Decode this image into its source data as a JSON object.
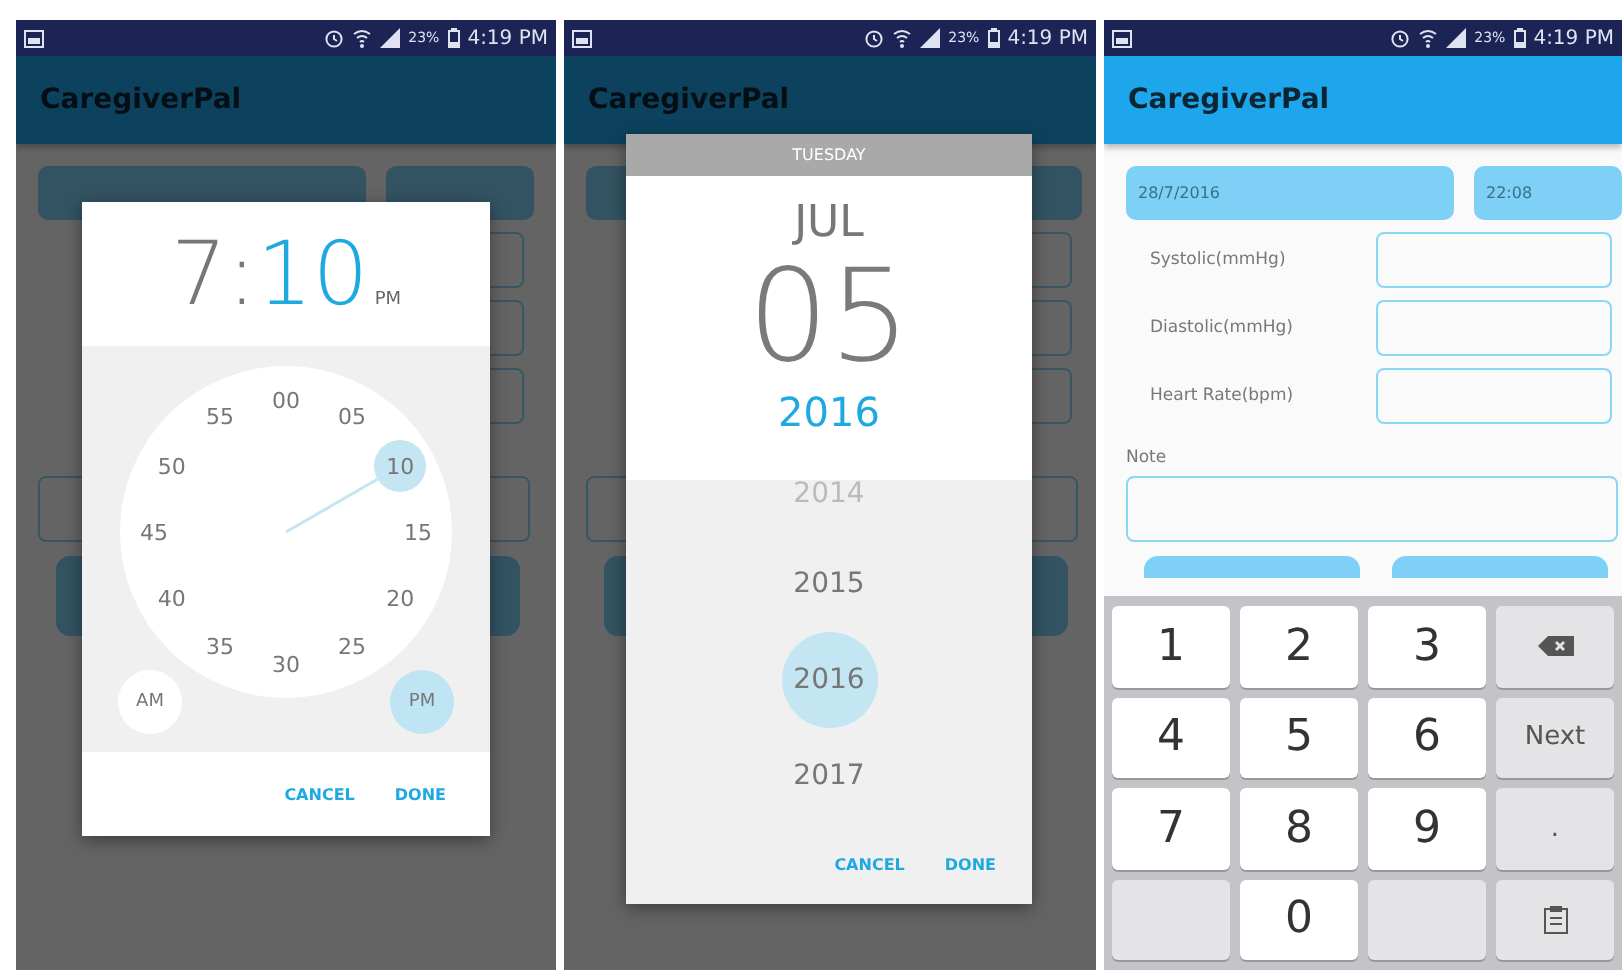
{
  "panels": [
    {
      "kind": "time_picker",
      "status_bar": {
        "battery": "23%",
        "time": "4:19 PM"
      },
      "app_title": "CaregiverPal",
      "dialog": {
        "hour": "7",
        "separator": ":",
        "minute": "10",
        "meridiem": "PM",
        "dial": [
          {
            "label": "00",
            "selected": false
          },
          {
            "label": "05",
            "selected": false
          },
          {
            "label": "10",
            "selected": true
          },
          {
            "label": "15",
            "selected": false
          },
          {
            "label": "20",
            "selected": false
          },
          {
            "label": "25",
            "selected": false
          },
          {
            "label": "30",
            "selected": false
          },
          {
            "label": "35",
            "selected": false
          },
          {
            "label": "40",
            "selected": false
          },
          {
            "label": "45",
            "selected": false
          },
          {
            "label": "50",
            "selected": false
          },
          {
            "label": "55",
            "selected": false
          }
        ],
        "periods": [
          {
            "label": "AM",
            "selected": false
          },
          {
            "label": "PM",
            "selected": true
          }
        ],
        "buttons": [
          "CANCEL",
          "DONE"
        ]
      }
    },
    {
      "kind": "date_picker",
      "status_bar": {
        "battery": "23%",
        "time": "4:19 PM"
      },
      "app_title": "CaregiverPal",
      "dialog": {
        "weekday": "TUESDAY",
        "month": "JUL",
        "day": "05",
        "year": "2016",
        "years": [
          {
            "label": "2014",
            "selected": false
          },
          {
            "label": "2015",
            "selected": false
          },
          {
            "label": "2016",
            "selected": true
          },
          {
            "label": "2017",
            "selected": false
          }
        ],
        "buttons": [
          "CANCEL",
          "DONE"
        ]
      }
    },
    {
      "kind": "form",
      "status_bar": {
        "battery": "23%",
        "time": "4:19 PM"
      },
      "app_title": "CaregiverPal",
      "date": "28/7/2016",
      "time": "22:08",
      "fields": [
        {
          "label": "Systolic(mmHg)"
        },
        {
          "label": "Diastolic(mmHg)"
        },
        {
          "label": "Heart Rate(bpm)"
        }
      ],
      "note_label": "Note",
      "keypad": [
        [
          {
            "kind": "digit",
            "label": "1"
          },
          {
            "kind": "digit",
            "label": "2"
          },
          {
            "kind": "digit",
            "label": "3"
          },
          {
            "kind": "backspace"
          }
        ],
        [
          {
            "kind": "digit",
            "label": "4"
          },
          {
            "kind": "digit",
            "label": "5"
          },
          {
            "kind": "digit",
            "label": "6"
          },
          {
            "kind": "action",
            "label": "Next"
          }
        ],
        [
          {
            "kind": "digit",
            "label": "7"
          },
          {
            "kind": "digit",
            "label": "8"
          },
          {
            "kind": "digit",
            "label": "9"
          },
          {
            "kind": "symbol",
            "label": "."
          }
        ],
        [
          {
            "kind": "blank"
          },
          {
            "kind": "digit",
            "label": "0"
          },
          {
            "kind": "blank"
          },
          {
            "kind": "clipboard"
          }
        ]
      ]
    }
  ]
}
